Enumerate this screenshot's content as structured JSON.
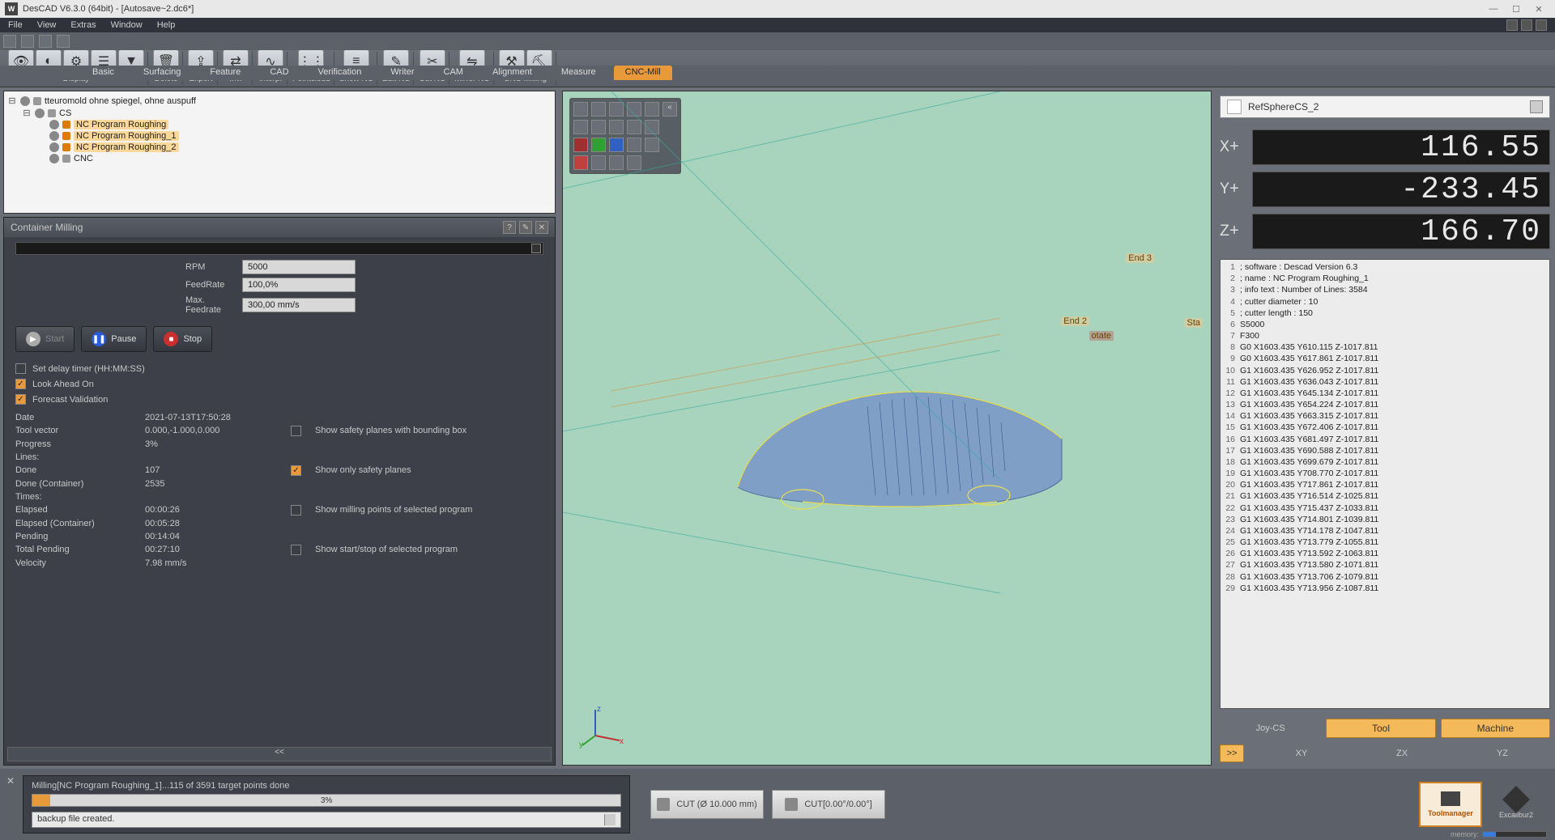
{
  "titlebar": {
    "app": "DesCAD V6.3.0 (64bit)",
    "doc": "[Autosave~2.dc6*]"
  },
  "menus": [
    "File",
    "View",
    "Extras",
    "Window",
    "Help"
  ],
  "ribbonTabs": [
    "Basic",
    "Surfacing",
    "Feature",
    "CAD",
    "Verification",
    "Writer",
    "CAM",
    "Alignment",
    "Measure",
    "CNC-Mill"
  ],
  "ribbonActive": "CNC-Mill",
  "ribbonButtons": {
    "display": "Display",
    "delete": "Delete",
    "export": "Export",
    "inv": "Inv.",
    "interp": "Interp.",
    "pointcloud": "Pointcloud",
    "shownc": "Show NC",
    "editnc": "Edit NC",
    "cutnc": "Cut NC",
    "mirrornc": "Mirror NC",
    "cncmill": "CNC Milling"
  },
  "tree": {
    "root": "tteuromold ohne spiegel, ohne auspuff",
    "items": [
      "CS",
      "NC Program Roughing",
      "NC Program Roughing_1",
      "NC Program Roughing_2",
      "CNC"
    ]
  },
  "container": {
    "title": "Container Milling",
    "params": {
      "rpm_label": "RPM",
      "rpm_value": "5000",
      "feed_label": "FeedRate",
      "feed_value": "100,0%",
      "maxfeed_label": "Max. Feedrate",
      "maxfeed_value": "300,00 mm/s"
    },
    "buttons": {
      "start": "Start",
      "pause": "Pause",
      "stop": "Stop"
    },
    "checks": {
      "delay": "Set delay timer (HH:MM:SS)",
      "lookahead": "Look Ahead On",
      "forecast": "Forecast Validation",
      "safety_bbox": "Show safety planes with bounding box",
      "safety_only": "Show only safety planes",
      "mill_points": "Show milling points of selected program",
      "startstop": "Show start/stop of selected program"
    },
    "info": {
      "date_l": "Date",
      "date_v": "2021-07-13T17:50:28",
      "tv_l": "Tool vector",
      "tv_v": "0.000,-1.000,0.000",
      "prog_l": "Progress",
      "prog_v": "3%",
      "lines_l": "Lines:",
      "lines_v": "",
      "done_l": "Done",
      "done_v": "107",
      "donec_l": "Done (Container)",
      "donec_v": "2535",
      "times_l": "Times:",
      "times_v": "",
      "el_l": "Elapsed",
      "el_v": "00:00:26",
      "elc_l": "Elapsed (Container)",
      "elc_v": "00:05:28",
      "pend_l": "Pending",
      "pend_v": "00:14:04",
      "tpend_l": "Total Pending",
      "tpend_v": "00:27:10",
      "vel_l": "Velocity",
      "vel_v": "7.98 mm/s"
    },
    "collapse": "<<"
  },
  "viewport": {
    "labels": {
      "end2": "End 2",
      "end3": "End 3",
      "start": "Sta",
      "rotate": "otate"
    },
    "axes": {
      "x": "x",
      "y": "y",
      "z": "z"
    }
  },
  "dro": {
    "cs": "RefSphereCS_2",
    "x_label": "X+",
    "x_val": "116.55",
    "y_label": "Y+",
    "y_val": "-233.45",
    "z_label": "Z+",
    "z_val": "166.70"
  },
  "nc": [
    "; software     : Descad Version 6.3",
    "; name         : NC Program Roughing_1",
    "; info text    : Number of Lines: 3584",
    "; cutter diameter  : 10",
    "; cutter length    : 150",
    "S5000",
    "F300",
    "G0 X1603.435 Y610.115 Z-1017.811",
    "G0 X1603.435 Y617.861 Z-1017.811",
    "G1 X1603.435 Y626.952 Z-1017.811",
    "G1 X1603.435 Y636.043 Z-1017.811",
    "G1 X1603.435 Y645.134 Z-1017.811",
    "G1 X1603.435 Y654.224 Z-1017.811",
    "G1 X1603.435 Y663.315 Z-1017.811",
    "G1 X1603.435 Y672.406 Z-1017.811",
    "G1 X1603.435 Y681.497 Z-1017.811",
    "G1 X1603.435 Y690.588 Z-1017.811",
    "G1 X1603.435 Y699.679 Z-1017.811",
    "G1 X1603.435 Y708.770 Z-1017.811",
    "G1 X1603.435 Y717.861 Z-1017.811",
    "G1 X1603.435 Y716.514 Z-1025.811",
    "G1 X1603.435 Y715.437 Z-1033.811",
    "G1 X1603.435 Y714.801 Z-1039.811",
    "G1 X1603.435 Y714.178 Z-1047.811",
    "G1 X1603.435 Y713.779 Z-1055.811",
    "G1 X1603.435 Y713.592 Z-1063.811",
    "G1 X1603.435 Y713.580 Z-1071.811",
    "G1 X1603.435 Y713.706 Z-1079.811",
    "G1 X1603.435 Y713.956 Z-1087.811"
  ],
  "tabs": {
    "shift": ">>",
    "joy": "Joy-CS",
    "tool": "Tool",
    "machine": "Machine",
    "xy": "XY",
    "zx": "ZX",
    "yz": "YZ"
  },
  "status": {
    "prog_text": "Milling[NC Program Roughing_1]...115 of 3591 target points done",
    "prog_pct": "3%",
    "prog_fill": 3,
    "log": "backup file created.",
    "cut1": "CUT (Ø 10.000 mm)",
    "cut2": "CUT[0.00°/0.00°]",
    "toolmgr": "Toolmanager",
    "excal": "Excalibur2",
    "memory": "memory:"
  }
}
